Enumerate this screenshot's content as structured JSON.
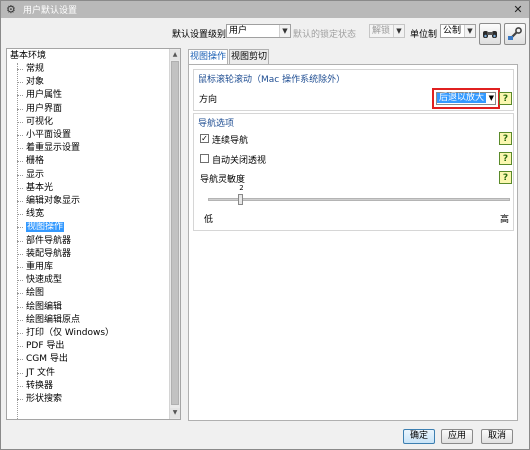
{
  "window": {
    "title": "用户默认设置"
  },
  "toolbar": {
    "level_label": "默认设置级别",
    "level_value": "用户",
    "lock_label": "默认的锁定状态",
    "lock_value": "解锁",
    "unit_label": "单位制",
    "unit_value": "公制"
  },
  "tree": {
    "root": "基本环境",
    "items": [
      "常规",
      "对象",
      "用户属性",
      "用户界面",
      "可视化",
      "小平面设置",
      "着重显示设置",
      "栅格",
      "显示",
      "基本光",
      "编辑对象显示",
      "线宽",
      "视图操作",
      "部件导航器",
      "装配导航器",
      "重用库",
      "快速成型",
      "绘图",
      "绘图编辑",
      "绘图编辑原点",
      "打印（仅 Windows）",
      "PDF 导出",
      "CGM 导出",
      "JT 文件",
      "转换器",
      "形状搜索"
    ],
    "selected_index": 12
  },
  "tabs": [
    {
      "label": "视图操作",
      "active": true
    },
    {
      "label": "视图剪切",
      "active": false
    }
  ],
  "mouse_wheel": {
    "title": "鼠标滚轮滚动（Mac 操作系统除外）",
    "direction_label": "方向",
    "direction_value": "后退以放大"
  },
  "navigation": {
    "title": "导航选项",
    "continuous_label": "连续导航",
    "continuous_checked": true,
    "auto_close_label": "自动关闭透视",
    "auto_close_checked": false,
    "sensitivity_label": "导航灵敏度",
    "sensitivity_value": "2",
    "slider_min_label": "低",
    "slider_max_label": "高"
  },
  "help_glyph": "?",
  "buttons": {
    "ok": "确定",
    "apply": "应用",
    "cancel": "取消"
  }
}
